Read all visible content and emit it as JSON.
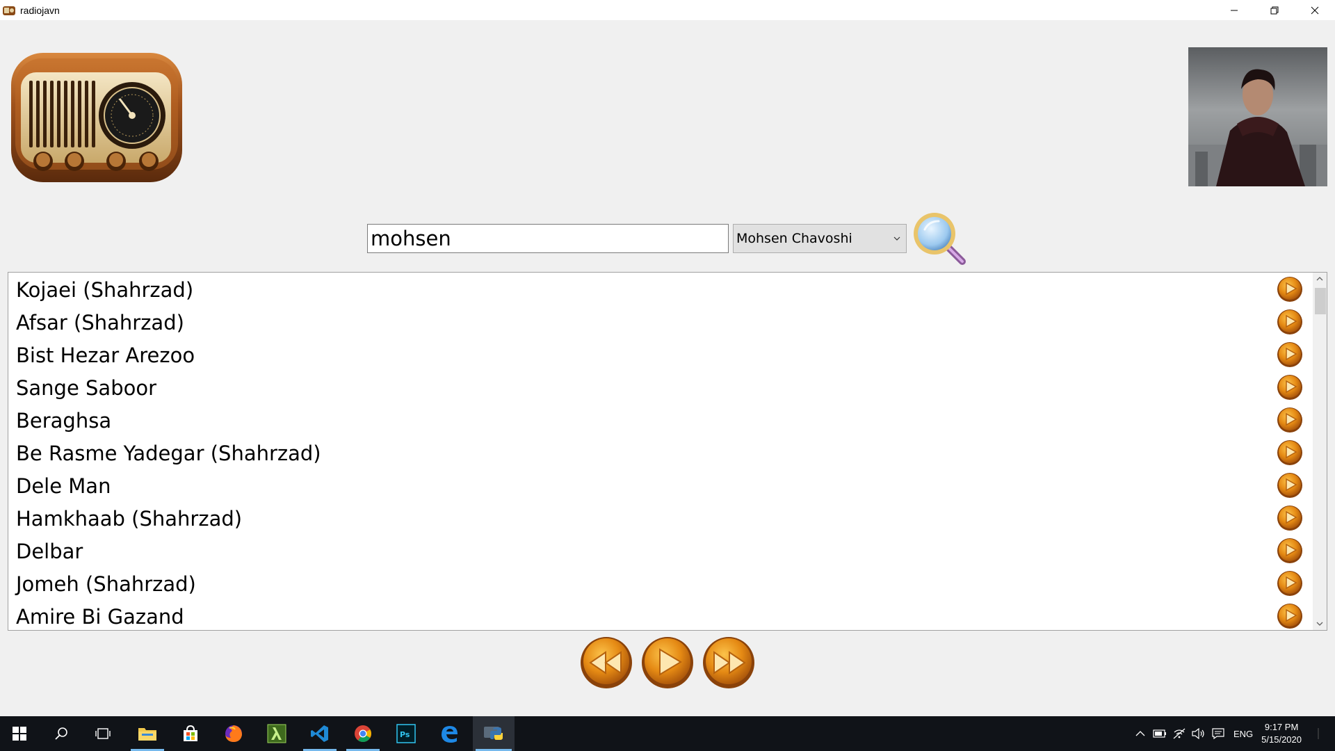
{
  "window": {
    "title": "radiojavn",
    "minimize_icon": "minimize-icon",
    "maximize_icon": "restore-icon",
    "close_icon": "close-icon"
  },
  "search": {
    "value": "mohsen",
    "placeholder": ""
  },
  "artist_select": {
    "selected": "Mohsen Chavoshi"
  },
  "songs": [
    "Kojaei (Shahrzad)",
    "Afsar (Shahrzad)",
    "Bist Hezar Arezoo",
    "Sange Saboor",
    "Beraghsa",
    "Be Rasme Yadegar (Shahrzad)",
    "Dele Man",
    "Hamkhaab (Shahrzad)",
    "Delbar",
    "Jomeh (Shahrzad)",
    "Amire Bi Gazand"
  ],
  "player": {
    "prev_icon": "rewind-icon",
    "play_icon": "play-icon",
    "next_icon": "fast-forward-icon"
  },
  "taskbar": {
    "apps": [
      "start",
      "search",
      "task-view",
      "file-explorer",
      "store",
      "firefox",
      "lambda-app",
      "vscode",
      "chrome",
      "photoshop",
      "edge",
      "python"
    ],
    "language": "ENG",
    "time": "9:17 PM",
    "date": "5/15/2020"
  },
  "colors": {
    "accent_orange": "#e8891a",
    "window_bg": "#f0f0f0",
    "taskbar_bg": "#101318"
  }
}
